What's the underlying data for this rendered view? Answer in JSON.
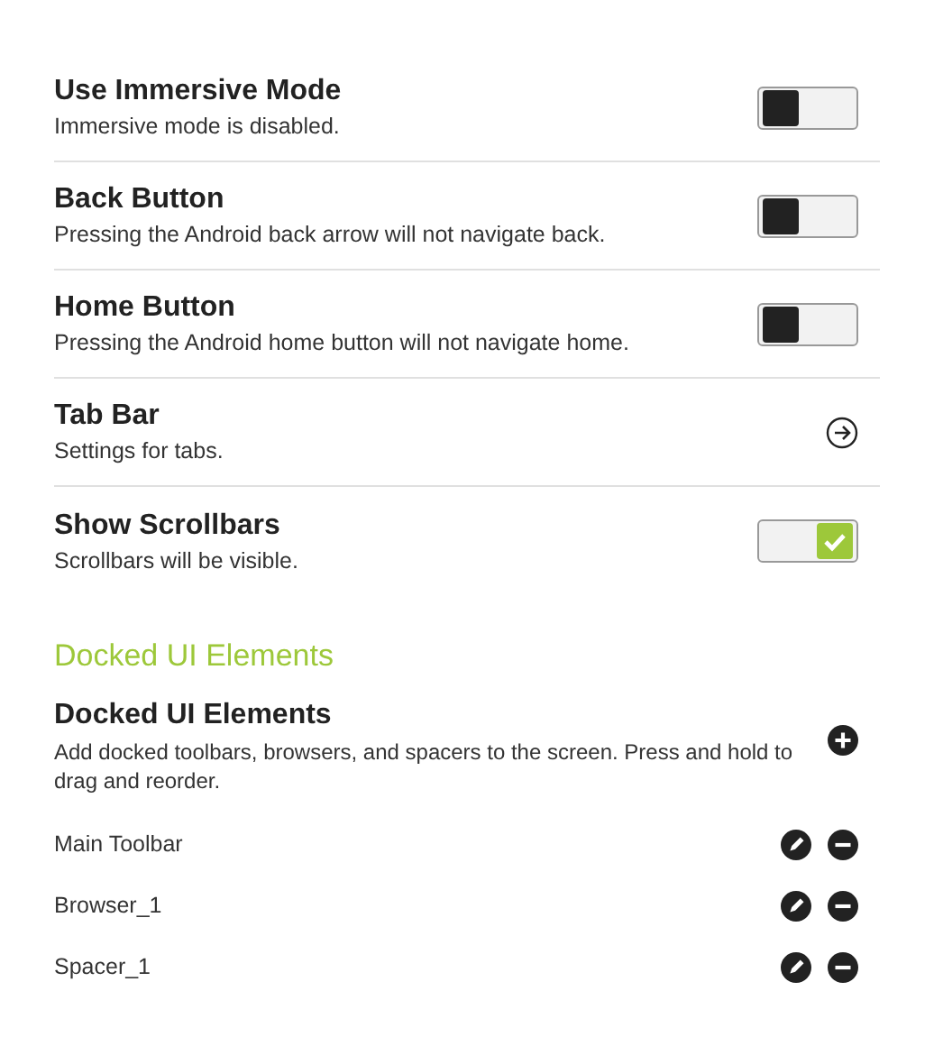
{
  "settings": [
    {
      "kind": "toggle",
      "title": "Use Immersive Mode",
      "subtitle": "Immersive mode is disabled.",
      "on": false
    },
    {
      "kind": "toggle",
      "title": "Back Button",
      "subtitle": "Pressing the Android back arrow will not navigate back.",
      "on": false
    },
    {
      "kind": "toggle",
      "title": "Home Button",
      "subtitle": "Pressing the Android home button will not navigate home.",
      "on": false
    },
    {
      "kind": "link",
      "title": "Tab Bar",
      "subtitle": "Settings for tabs."
    },
    {
      "kind": "toggle",
      "title": "Show Scrollbars",
      "subtitle": "Scrollbars will be visible.",
      "on": true
    }
  ],
  "section_heading": "Docked UI Elements",
  "docked": {
    "title": "Docked UI Elements",
    "description": "Add docked toolbars, browsers, and spacers to the screen. Press and hold to drag and reorder.",
    "items": [
      {
        "label": "Main Toolbar"
      },
      {
        "label": "Browser_1"
      },
      {
        "label": "Spacer_1"
      }
    ]
  }
}
